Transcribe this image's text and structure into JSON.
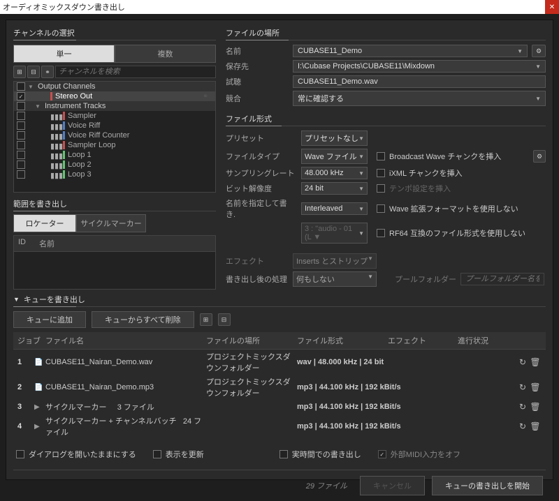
{
  "window": {
    "title": "オーディオミックスダウン書き出し"
  },
  "channel_select": {
    "legend": "チャンネルの選択",
    "tab_single": "単一",
    "tab_multi": "複数",
    "search_placeholder": "チャンネルを検索",
    "groups": {
      "output": "Output Channels",
      "instrument": "Instrument Tracks"
    },
    "rows": [
      {
        "label": "Stereo Out",
        "color": "#c74f4f",
        "checked": true,
        "selected": true
      },
      {
        "label": "Sampler",
        "color": "#c74f4f"
      },
      {
        "label": "Voice Riff",
        "color": "#4f7fc7"
      },
      {
        "label": "Voice Riff Counter",
        "color": "#4f7fc7"
      },
      {
        "label": "Sampler Loop",
        "color": "#c74f4f"
      },
      {
        "label": "Loop 1",
        "color": "#5fc76f"
      },
      {
        "label": "Loop 2",
        "color": "#5fc76f"
      },
      {
        "label": "Loop 3",
        "color": "#5fc76f"
      }
    ]
  },
  "range": {
    "legend": "範囲を書き出し",
    "tab_locator": "ロケーター",
    "tab_cycle": "サイクルマーカー",
    "col_id": "ID",
    "col_name": "名前"
  },
  "file_location": {
    "legend": "ファイルの場所",
    "name_lbl": "名前",
    "name_val": "CUBASE11_Demo",
    "dest_lbl": "保存先",
    "dest_val": "I:\\Cubase Projects\\CUBASE11\\Mixdown",
    "preview_lbl": "試聴",
    "preview_val": "CUBASE11_Demo.wav",
    "conflict_lbl": "競合",
    "conflict_val": "常に確認する"
  },
  "file_format": {
    "legend": "ファイル形式",
    "preset_lbl": "プリセット",
    "preset_val": "プリセットなし",
    "type_lbl": "ファイルタイプ",
    "type_val": "Wave ファイル",
    "rate_lbl": "サンプリングレート",
    "rate_val": "48.000 kHz",
    "depth_lbl": "ビット解像度",
    "depth_val": "24 bit",
    "name_lbl": "名前を指定して書き.",
    "name_val": "Interleaved",
    "scheme_val": "3 : \"audio - 01 (L ▼",
    "chk_bwave": "Broadcast Wave チャンクを挿入",
    "chk_ixml": "iXML チャンクを挿入",
    "chk_tempo": "テンポ設定を挿入",
    "chk_wave_ext": "Wave 拡張フォーマットを使用しない",
    "chk_rf64": "RF64 互換のファイル形式を使用しない"
  },
  "effects": {
    "lbl": "エフェクト",
    "val": "Inserts とストリップ",
    "post_lbl": "書き出し後の処理",
    "post_val": "何もしない",
    "pool_lbl": "プールフォルダー",
    "pool_placeholder": "プールフォルダー名を入"
  },
  "queue": {
    "legend": "キューを書き出し",
    "btn_add": "キューに追加",
    "btn_clear": "キューからすべて削除",
    "hdr_job": "ジョブ",
    "hdr_file": "ファイル名",
    "hdr_loc": "ファイルの場所",
    "hdr_fmt": "ファイル形式",
    "hdr_fx": "エフェクト",
    "hdr_prog": "進行状況",
    "rows": [
      {
        "idx": "1",
        "icon": "doc",
        "name": "CUBASE11_Nairan_Demo.wav",
        "loc": "プロジェクトミックスダウンフォルダー",
        "fmt": "wav | 48.000 kHz | 24 bit"
      },
      {
        "idx": "2",
        "icon": "doc",
        "name": "CUBASE11_Nairan_Demo.mp3",
        "loc": "プロジェクトミックスダウンフォルダー",
        "fmt": "mp3 | 44.100 kHz | 192 kBit/s"
      },
      {
        "idx": "3",
        "icon": "play",
        "name": "サイクルマーカー",
        "files": "3 ファイル",
        "fmt": "mp3 | 44.100 kHz | 192 kBit/s"
      },
      {
        "idx": "4",
        "icon": "play",
        "name": "サイクルマーカー + チャンネルバッチ",
        "files": "24 ファイル",
        "fmt": "mp3 | 44.100 kHz | 192 kBit/s"
      }
    ]
  },
  "footer": {
    "keep_open": "ダイアログを開いたままにする",
    "refresh": "表示を更新",
    "realtime": "実時間での書き出し",
    "ext_midi": "外部MIDI入力をオフ",
    "count": "29 ファイル",
    "cancel": "キャンセル",
    "start": "キューの書き出しを開始"
  }
}
